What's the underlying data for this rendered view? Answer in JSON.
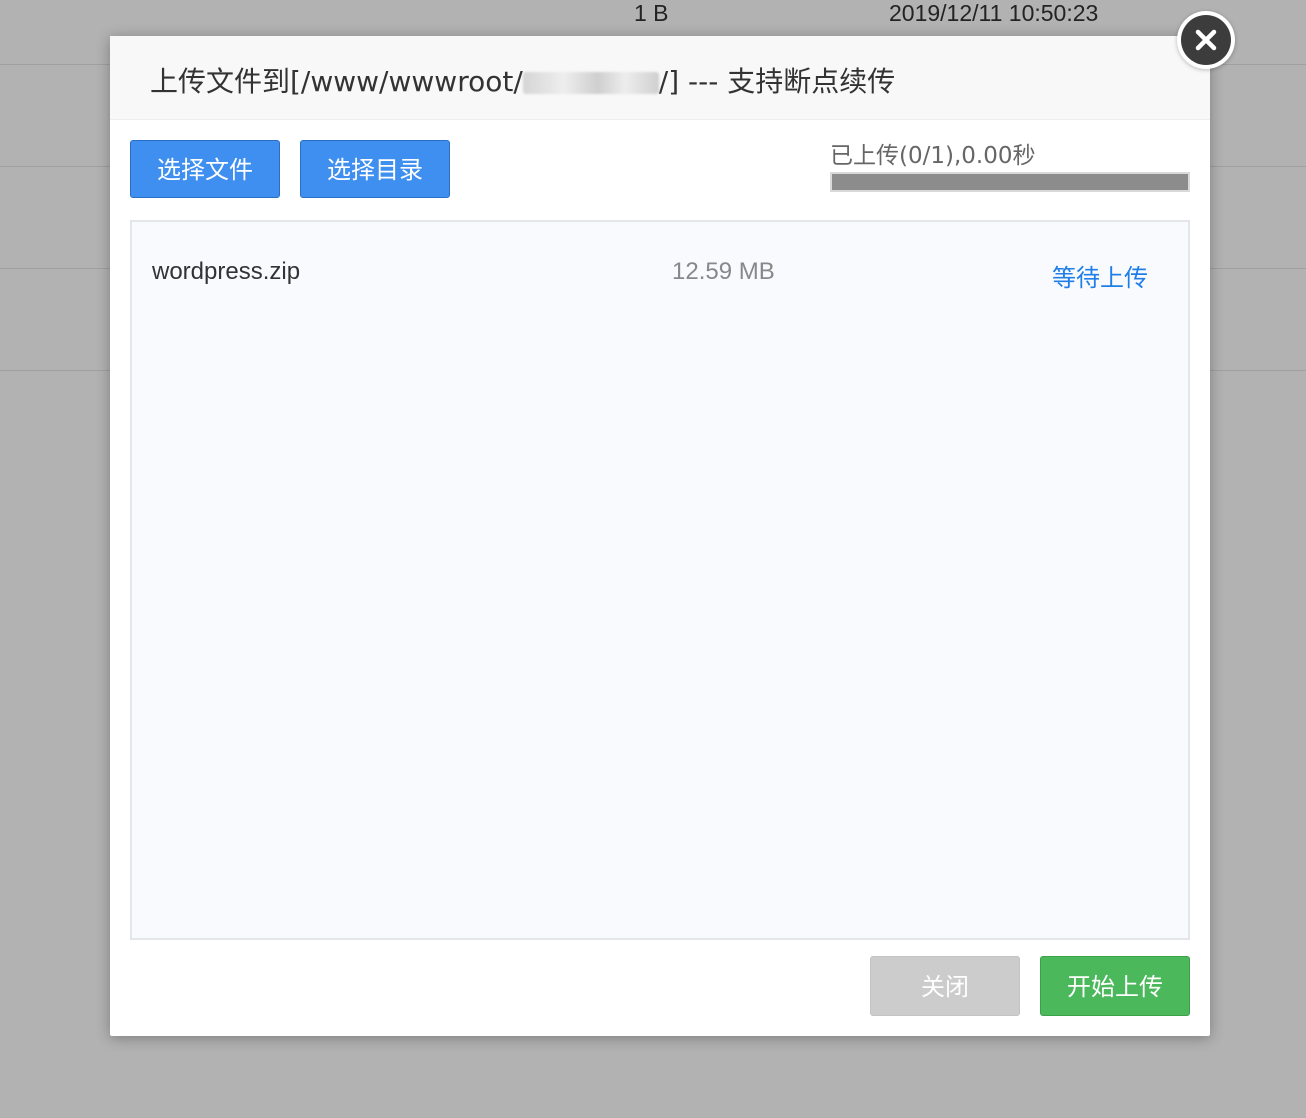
{
  "background": {
    "file_size": "1 B",
    "modified_time": "2019/12/11 10:50:23"
  },
  "dialog": {
    "title_prefix": "上传文件到[/www/wwwroot/",
    "title_suffix": "/] --- 支持断点续传",
    "select_file_label": "选择文件",
    "select_dir_label": "选择目录",
    "progress_text": "已上传(0/1),0.00秒",
    "progress_fraction": 0,
    "close_label": "关闭",
    "start_upload_label": "开始上传"
  },
  "files": [
    {
      "name": "wordpress.zip",
      "size": "12.59 MB",
      "status": "等待上传"
    }
  ],
  "colors": {
    "primary_button": "#3f8ff0",
    "start_button": "#4cb85c",
    "close_button": "#cccccc",
    "status_link": "#1f7ee8"
  },
  "icons": {
    "close": "close-circle-icon"
  }
}
